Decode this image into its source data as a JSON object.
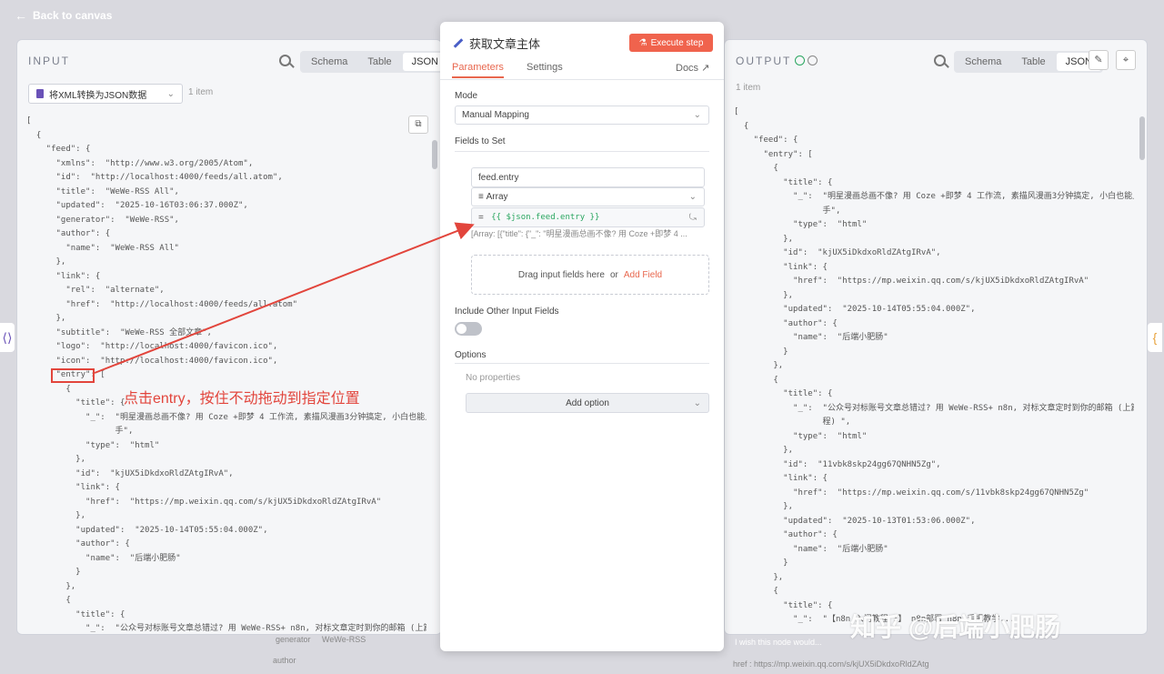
{
  "topbar": {
    "back_label": "Back to canvas"
  },
  "input": {
    "title": "INPUT",
    "view_tabs": [
      "Schema",
      "Table",
      "JSON"
    ],
    "source_node": "将XML转换为JSON数据",
    "item_count": "1 item",
    "json_lines": [
      "[",
      "  {",
      "    \"feed\": {",
      "      \"xmlns\":  \"http://www.w3.org/2005/Atom\",",
      "      \"id\":  \"http://localhost:4000/feeds/all.atom\",",
      "      \"title\":  \"WeWe-RSS All\",",
      "      \"updated\":  \"2025-10-16T03:06:37.000Z\",",
      "      \"generator\":  \"WeWe-RSS\",",
      "      \"author\": {",
      "        \"name\":  \"WeWe-RSS All\"",
      "      },",
      "      \"link\": {",
      "        \"rel\":  \"alternate\",",
      "        \"href\":  \"http://localhost:4000/feeds/all.atom\"",
      "      },",
      "      \"subtitle\":  \"WeWe-RSS 全部文章\",",
      "      \"logo\":  \"http://localhost:4000/favicon.ico\",",
      "      \"icon\":  \"http://localhost:4000/favicon.ico\",",
      "      \"entry\": [",
      "        {",
      "          \"title\": {",
      "            \"_\":  \"明星漫画总画不像? 用 Coze +即梦 4 工作流, 素描风漫画3分钟搞定, 小白也能上",
      "                  手\",",
      "            \"type\":  \"html\"",
      "          },",
      "          \"id\":  \"kjUX5iDkdxoRldZAtgIRvA\",",
      "          \"link\": {",
      "            \"href\":  \"https://mp.weixin.qq.com/s/kjUX5iDkdxoRldZAtgIRvA\"",
      "          },",
      "          \"updated\":  \"2025-10-14T05:55:04.000Z\",",
      "          \"author\": {",
      "            \"name\":  \"后端小肥肠\"",
      "          }",
      "        },",
      "        {",
      "          \"title\": {",
      "            \"_\":  \"公众号对标账号文章总错过? 用 WeWe-RSS+ n8n, 对标文章定时到你的邮箱 (上篇教"
    ],
    "annotation": "点击entry，按住不动拖动到指定位置"
  },
  "node": {
    "title": "获取文章主体",
    "execute_label": "Execute step",
    "tabs": [
      "Parameters",
      "Settings"
    ],
    "docs_label": "Docs",
    "mode_label": "Mode",
    "mode_value": "Manual Mapping",
    "fields_label": "Fields to Set",
    "field_name": "feed.entry",
    "field_type": "Array",
    "field_expression": "{{ $json.feed.entry }}",
    "field_preview": "[Array: [{\"title\": {\"_\": \"明星漫画总画不像? 用 Coze +即梦 4 ...",
    "drop_text": "Drag input fields here",
    "drop_or": "or",
    "add_field_label": "Add Field",
    "include_label": "Include Other Input Fields",
    "include_enabled": false,
    "options_label": "Options",
    "no_properties": "No properties",
    "add_option_label": "Add option"
  },
  "output": {
    "title": "OUTPUT",
    "view_tabs": [
      "Schema",
      "Table",
      "JSON"
    ],
    "item_count": "1 item",
    "json_lines": [
      "[",
      "  {",
      "    \"feed\": {",
      "      \"entry\": [",
      "        {",
      "          \"title\": {",
      "            \"_\":  \"明星漫画总画不像? 用 Coze +即梦 4 工作流, 素描风漫画3分钟搞定, 小白也能上",
      "                  手\",",
      "            \"type\":  \"html\"",
      "          },",
      "          \"id\":  \"kjUX5iDkdxoRldZAtgIRvA\",",
      "          \"link\": {",
      "            \"href\":  \"https://mp.weixin.qq.com/s/kjUX5iDkdxoRldZAtgIRvA\"",
      "          },",
      "          \"updated\":  \"2025-10-14T05:55:04.000Z\",",
      "          \"author\": {",
      "            \"name\":  \"后端小肥肠\"",
      "          }",
      "        },",
      "        {",
      "          \"title\": {",
      "            \"_\":  \"公众号对标账号文章总错过? 用 WeWe-RSS+ n8n, 对标文章定时到你的邮箱 (上篇教",
      "                  程) \",",
      "            \"type\":  \"html\"",
      "          },",
      "          \"id\":  \"11vbk8skp24gg67QNHN5Zg\",",
      "          \"link\": {",
      "            \"href\":  \"https://mp.weixin.qq.com/s/11vbk8skp24gg67QNHN5Zg\"",
      "          },",
      "          \"updated\":  \"2025-10-13T01:53:06.000Z\",",
      "          \"author\": {",
      "            \"name\":  \"后端小肥肠\"",
      "          }",
      "        },",
      "        {",
      "          \"title\": {",
      "            \"_\":  \"【n8n 入门教程 1】 n8n部署 n8n 手把教学..."
    ],
    "feedback_label": "I wish this node would..."
  },
  "background": {
    "row1_key": "generator",
    "row1_val": "WeWe-RSS",
    "row2_key": "author",
    "row3": "href : https://mp.weixin.qq.com/s/kjUX5iDkdxoRldZAtg"
  },
  "watermark": "知乎 @后端小肥肠"
}
